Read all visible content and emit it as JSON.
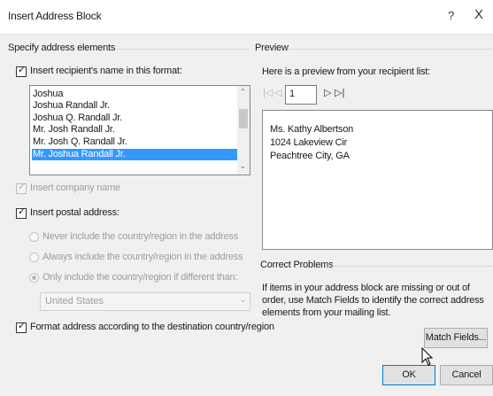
{
  "window": {
    "title": "Insert Address Block",
    "help": "?",
    "close": "X"
  },
  "left": {
    "header": "Specify address elements",
    "name_checkbox_label": "Insert recipient's name in this format:",
    "name_formats": [
      "Joshua",
      "Joshua Randall Jr.",
      "Joshua Q. Randall Jr.",
      "Mr. Josh Randall Jr.",
      "Mr. Josh Q. Randall Jr.",
      "Mr. Joshua Randall Jr."
    ],
    "selected_format": "Mr. Joshua Randall Jr.",
    "company_label": "Insert company name",
    "postal_label": "Insert postal address:",
    "radio_never": "Never include the country/region in the address",
    "radio_always": "Always include the country/region in the address",
    "radio_only": "Only include the country/region if different than:",
    "country_value": "United States",
    "format_label": "Format address according to the destination country/region"
  },
  "right": {
    "preview_header": "Preview",
    "preview_intro": "Here is a preview from your recipient list:",
    "page_value": "1",
    "preview_lines": [
      "Ms. Kathy Albertson",
      "1024 Lakeview Cir",
      "Peachtree City, GA"
    ],
    "correct_header": "Correct Problems",
    "correct_text": "If items in your address block are missing or out of order, use Match Fields to identify the correct address elements from your mailing list.",
    "match_fields_label": "Match Fields..."
  },
  "buttons": {
    "ok": "OK",
    "cancel": "Cancel"
  },
  "icons": {
    "first": "first-record-icon",
    "prev": "previous-record-icon",
    "next": "next-record-icon",
    "last": "last-record-icon",
    "check": "checkmark-icon",
    "dropdown": "chevron-down-icon"
  }
}
